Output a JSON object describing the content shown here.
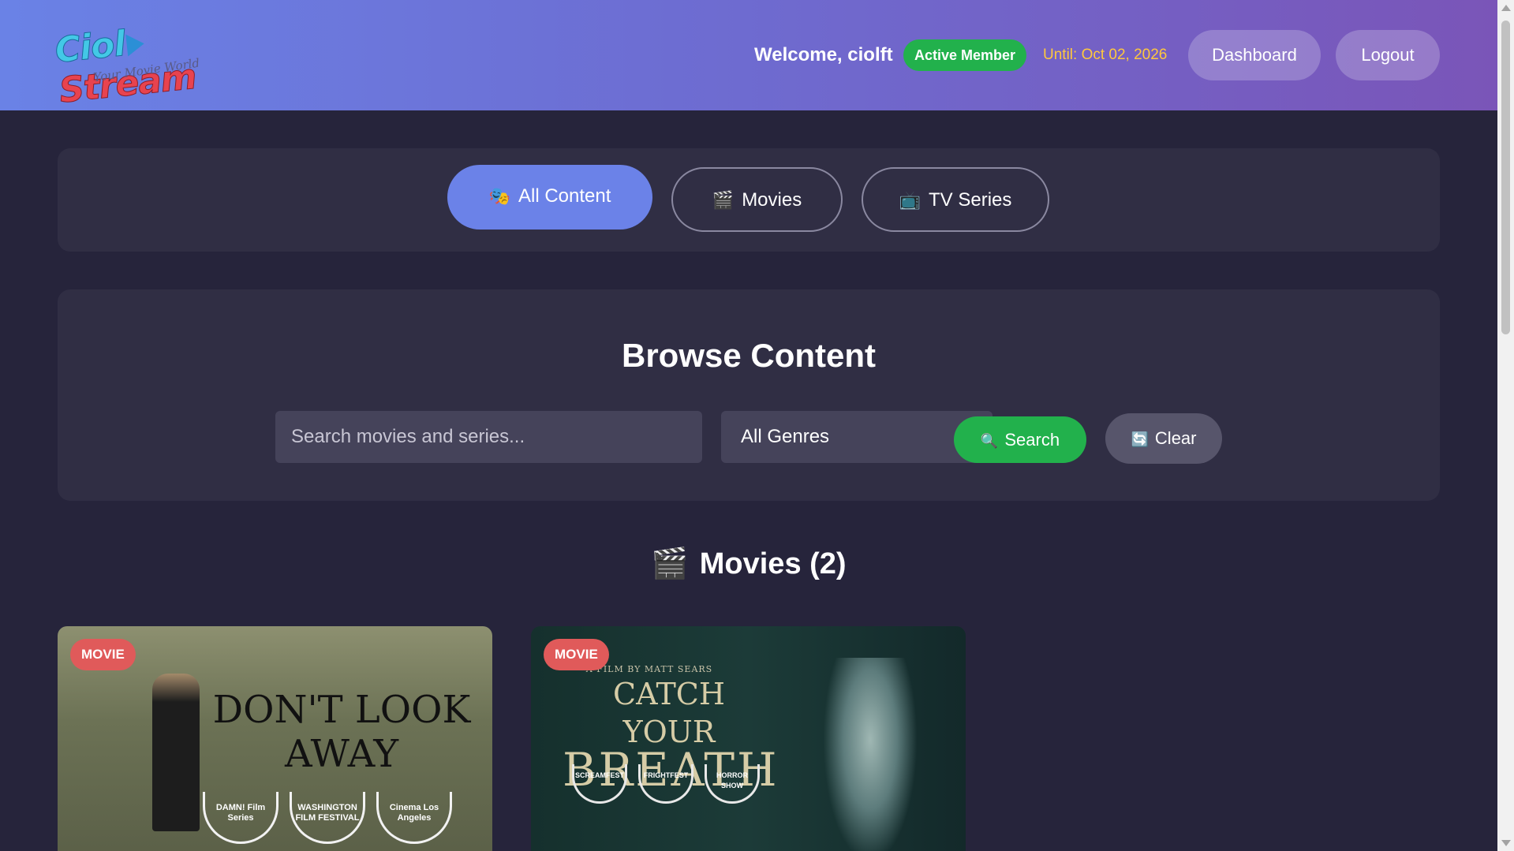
{
  "header": {
    "logo_text_a": "Ciol",
    "logo_text_b": "Stream",
    "logo_tagline": "Your Movie World",
    "welcome": "Welcome, ciolft",
    "member_badge": "Active Member",
    "until": "Until: Oct 02, 2026",
    "dashboard_label": "Dashboard",
    "logout_label": "Logout"
  },
  "tabs": [
    {
      "icon": "🎭",
      "label": "All Content",
      "active": true
    },
    {
      "icon": "🎬",
      "label": "Movies",
      "active": false
    },
    {
      "icon": "📺",
      "label": "TV Series",
      "active": false
    }
  ],
  "browse": {
    "title": "Browse Content",
    "search_placeholder": "Search movies and series...",
    "genre_selected": "All Genres",
    "search_label": "Search",
    "search_icon": "🔍",
    "clear_label": "Clear",
    "clear_icon": "🔄"
  },
  "section": {
    "icon": "🎬",
    "title": "Movies (2)"
  },
  "movies": [
    {
      "badge": "MOVIE",
      "poster_line1": "DON'T LOOK",
      "poster_line2": "AWAY",
      "laurels": [
        "DAMN! Film Series",
        "WASHINGTON FILM FESTIVAL",
        "Cinema Los Angeles"
      ]
    },
    {
      "badge": "MOVIE",
      "poster_credit": "A FILM BY MATT SEARS",
      "poster_line1": "CATCH YOUR",
      "poster_line2": "BREATH",
      "laurels": [
        "SCREAMFEST",
        "FRIGHTFEST",
        "HORROR SHOW"
      ]
    }
  ],
  "colors": {
    "accent": "#6b82e8",
    "success": "#22b14c",
    "badge": "#e05a5a",
    "gold": "#ffc83d",
    "background": "#26243b",
    "panel": "#302e44"
  }
}
